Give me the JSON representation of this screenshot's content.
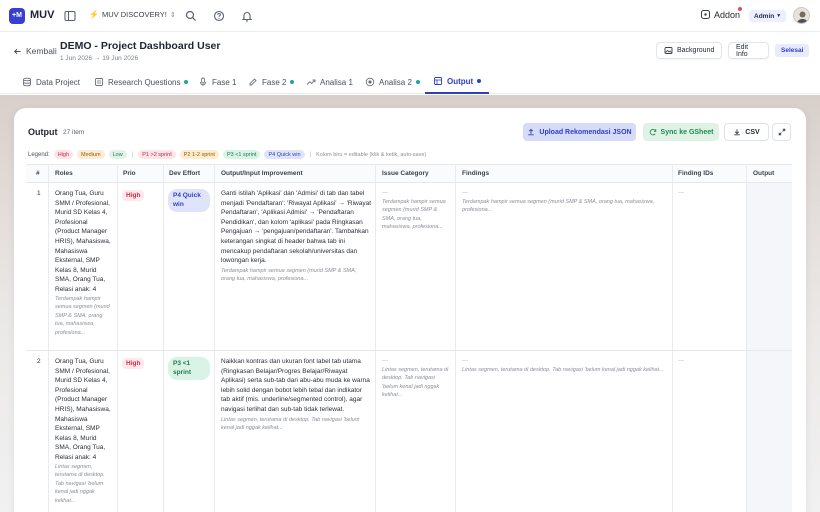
{
  "app": {
    "logo": "+M",
    "brand": "MUV",
    "workspace": "MUV DISCOVERY!",
    "addon_label": "Addon",
    "role": "Admin"
  },
  "header": {
    "back_label": "Kembali",
    "title": "DEMO - Project Dashboard User",
    "date_range": "1 Jun 2026 → 19 Jun 2026",
    "background_button": "Background",
    "edit_button": "Edit Info",
    "status_button": "Selesai"
  },
  "tabs": [
    {
      "label": "Data Project",
      "icon": "database-icon",
      "dot": false
    },
    {
      "label": "Research Questions",
      "icon": "list-icon",
      "dot": true
    },
    {
      "label": "Fase 1",
      "icon": "mic-icon",
      "dot": false
    },
    {
      "label": "Fase 2",
      "icon": "edit-icon",
      "dot": true
    },
    {
      "label": "Analisa 1",
      "icon": "trend-icon",
      "dot": false
    },
    {
      "label": "Analisa 2",
      "icon": "target-icon",
      "dot": true
    },
    {
      "label": "Output",
      "icon": "table-icon",
      "dot": true,
      "active": true
    }
  ],
  "output": {
    "title": "Output",
    "count": "27 item",
    "upload_button": "Upload Rekomendasi JSON",
    "sync_button": "Sync ke GSheet",
    "csv_button": "CSV"
  },
  "legend": {
    "label": "Legend:",
    "high": "High",
    "medium": "Medium",
    "low": "Low",
    "p1": "P1 >2 sprint",
    "p2": "P2 1-2 sprint",
    "p3": "P3 <1 sprint",
    "p4": "P4 Quick win",
    "note": "Kolom biru = editable (klik & ketik, auto-save)"
  },
  "table": {
    "columns": [
      "#",
      "Roles",
      "Prio",
      "Dev Effort",
      "Output/Input Improvement",
      "Issue Category",
      "Findings",
      "Finding IDs",
      "Output"
    ],
    "rows": [
      {
        "no": "1",
        "roles": "Orang Tua, Guru SMM / Profesional, Murid SD Kelas 4, Profesional (Product Manager HRIS), Mahasiswa, Mahasiswa Eksternal, SMP Kelas 8, Murid SMA, Orang Tua, Relasi anak: 4",
        "roles_note": "Terdampak hampir semua segmen (murid SMP & SMA, orang tua, mahasiswa, profesiona...",
        "prio": "High",
        "effort": "P4 Quick win",
        "improvement": "Ganti istilah 'Aplikasi' dan 'Admisi' di tab dan tabel menjadi 'Pendaftaran': 'Riwayat Aplikasi' → 'Riwayat Pendaftaran', 'Aplikasi Admisi' → 'Pendaftaran Pendidikan', dan kolom 'aplikasi' pada Ringkasan Pengajuan → 'pengajuan/pendaftaran'. Tambahkan keterangan singkat di header bahwa tab ini mencakup pendaftaran sekolah/universitas dan lowongan kerja.",
        "improvement_note": "Terdampak hampir semua segmen (murid SMP & SMA, orang tua, mahasiswa, profesiona...",
        "issue_dash": "—",
        "issue": "Terdampak hampir semua segmen (murid SMP & SMA, orang tua, mahasiswa, profesiona...",
        "findings_dash": "—",
        "findings": "Terdampak hampir semua segmen (murid SMP & SMA, orang tua, mahasiswa, profesiona...",
        "finding_ids": "—"
      },
      {
        "no": "2",
        "roles": "Orang Tua, Guru SMM / Profesional, Murid SD Kelas 4, Profesional (Product Manager HRIS), Mahasiswa, Mahasiswa Eksternal, SMP Kelas 8, Murid SMA, Orang Tua, Relasi anak: 4",
        "roles_note": "Lintas segmen, terutama di desktop. Tab navigasi 'belum kenal jadi nggak kelihat...",
        "prio": "High",
        "effort": "P3 <1 sprint",
        "improvement": "Naikkan kontras dan ukuran font label tab utama (Ringkasan Belajar/Progres Belajar/Riwayat Aplikasi) serta sub-tab dari abu-abu muda ke warna lebih solid dengan bobot lebih tebal dan indikator tab aktif (mis. underline/segmented control), agar navigasi terlihat dan sub-tab tidak terlewat.",
        "improvement_note": "Lintas segmen, terutama di desktop. Tab navigasi 'belum kenal jadi nggak kelihat...",
        "issue_dash": "—",
        "issue": "Lintas segmen, terutama di desktop. Tab navigasi 'belum kenal jadi nggak kelihat...",
        "findings_dash": "—",
        "findings": "Lintas segmen, terutama di desktop. Tab navigasi 'belum kenal jadi nggak kelihat...",
        "finding_ids": "—"
      }
    ]
  },
  "colors": {
    "accent": "#2f3fc4",
    "high": "#d22c42",
    "success": "#1f8a50"
  }
}
